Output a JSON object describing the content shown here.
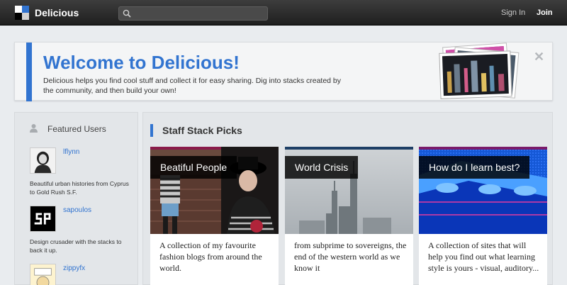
{
  "topbar": {
    "brand": "Delicious",
    "search_placeholder": "",
    "signin_label": "Sign In",
    "join_label": "Join"
  },
  "welcome": {
    "title": "Welcome to Delicious!",
    "text": "Delicious helps you find cool stuff and collect it for easy sharing. Dig into stacks created by the community, and then build your own!",
    "close_icon": "close-icon"
  },
  "featured": {
    "title": "Featured Users",
    "users": [
      {
        "name": "lflynn",
        "description": "Beautiful urban histories from Cyprus to Gold Rush S.F."
      },
      {
        "name": "sapoulos",
        "description": "Design crusader with the stacks to back it up."
      },
      {
        "name": "zippyfx",
        "description": ""
      }
    ]
  },
  "picks": {
    "title": "Staff Stack Picks",
    "cards": [
      {
        "label": "Beatiful People",
        "description": "A collection of my favourite fashion blogs from around the world."
      },
      {
        "label": "World Crisis",
        "description": "from subprime to sovereigns, the end of the western world as we know it"
      },
      {
        "label": "How do I learn best?",
        "description": "A collection of sites that will help you find out what learning style is yours - visual, auditory..."
      }
    ]
  },
  "colors": {
    "accent": "#3274d0",
    "topbar": "#2a2a2a",
    "background": "#e9ecef"
  }
}
